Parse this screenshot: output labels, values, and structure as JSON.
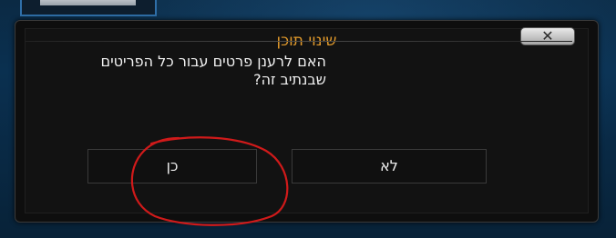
{
  "dialog": {
    "title": "שינוי תוכן",
    "message_line1": "האם לרענן פרטים עבור כל הפריטים",
    "message_line2": "שבנתיב זה?",
    "close_symbol": "✕"
  },
  "buttons": {
    "yes_label": "כן",
    "no_label": "לא"
  },
  "colors": {
    "title": "#e29a2b",
    "annotation_circle": "#d01a1a"
  }
}
